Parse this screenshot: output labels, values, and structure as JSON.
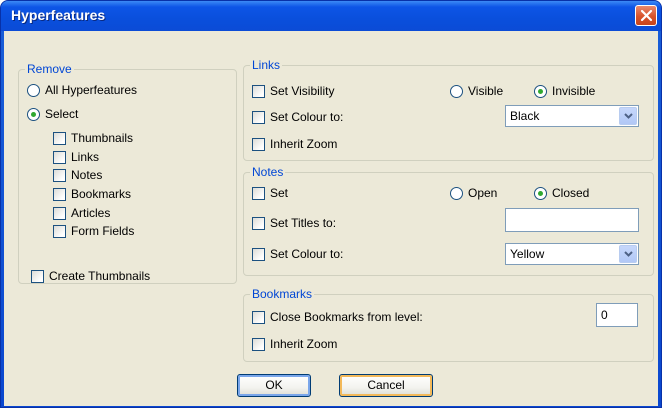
{
  "window": {
    "title": "Hyperfeatures"
  },
  "remove": {
    "legend": "Remove",
    "all_label": "All Hyperfeatures",
    "select_label": "Select",
    "items": [
      "Thumbnails",
      "Links",
      "Notes",
      "Bookmarks",
      "Articles",
      "Form Fields"
    ]
  },
  "create_thumbnails_label": "Create Thumbnails",
  "links": {
    "legend": "Links",
    "set_visibility_label": "Set Visibility",
    "visible_label": "Visible",
    "invisible_label": "Invisible",
    "set_colour_label": "Set Colour to:",
    "colour_value": "Black",
    "inherit_zoom_label": "Inherit Zoom"
  },
  "notes": {
    "legend": "Notes",
    "set_label": "Set",
    "open_label": "Open",
    "closed_label": "Closed",
    "set_titles_label": "Set Titles to:",
    "titles_value": "",
    "set_colour_label": "Set Colour to:",
    "colour_value": "Yellow"
  },
  "bookmarks": {
    "legend": "Bookmarks",
    "close_label": "Close Bookmarks from level:",
    "level_value": "0",
    "inherit_zoom_label": "Inherit Zoom"
  },
  "buttons": {
    "ok": "OK",
    "cancel": "Cancel"
  }
}
